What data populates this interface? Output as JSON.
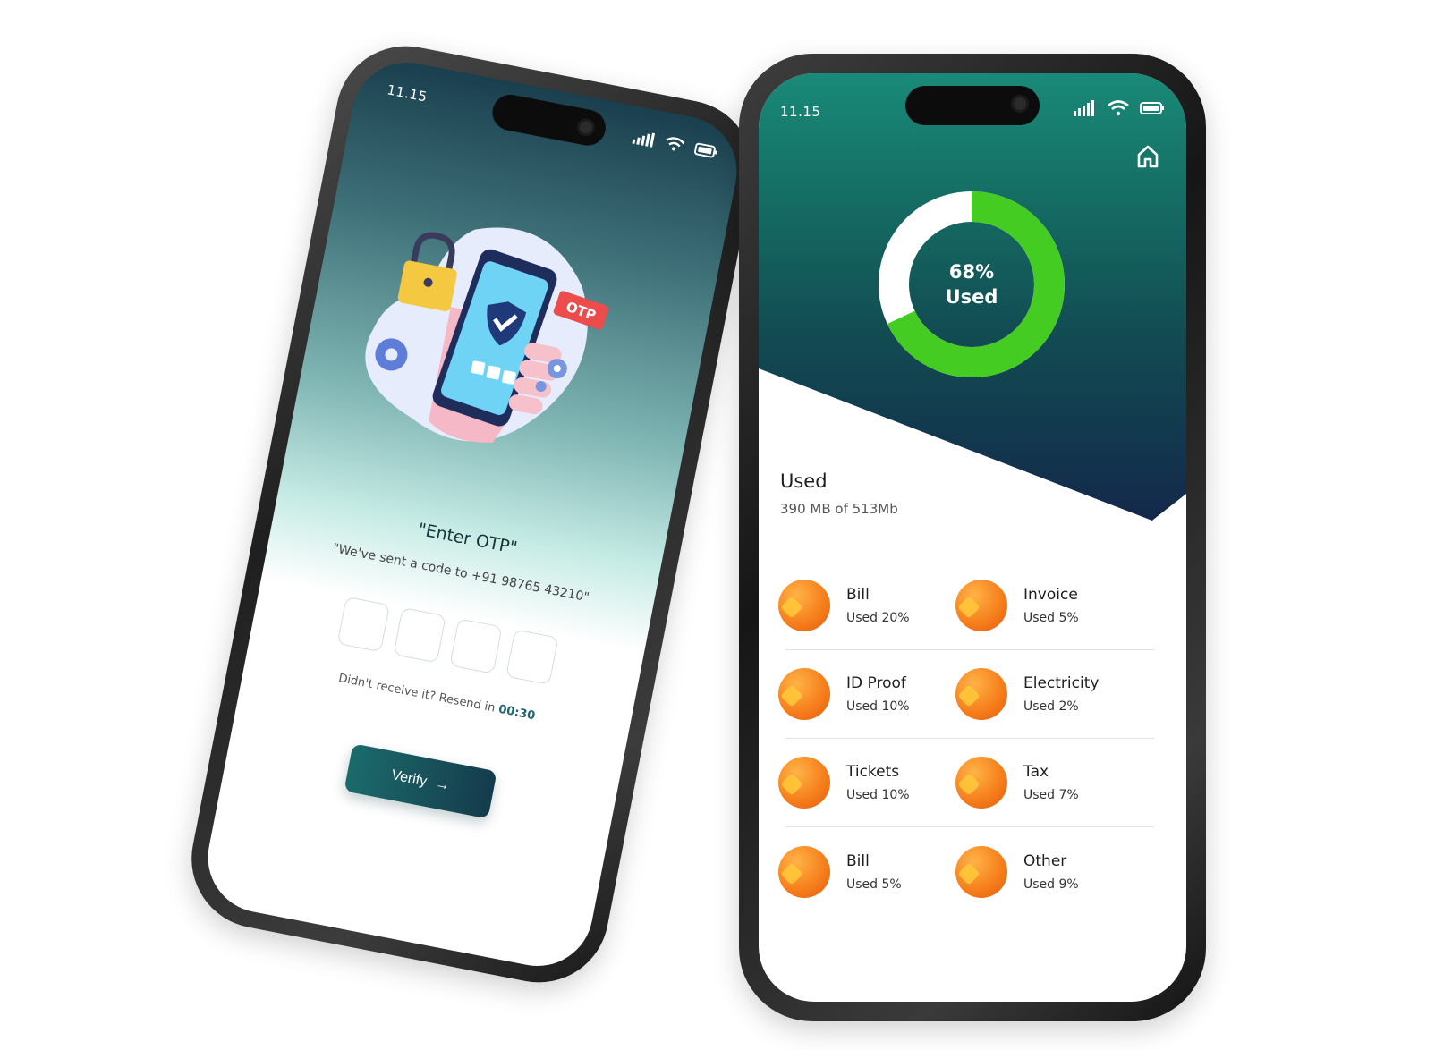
{
  "otp_screen": {
    "time": "11.15",
    "badge": "OTP",
    "title": "\"Enter OTP\"",
    "subtitle": "\"We've sent a code to +91 98765 43210\"",
    "resend_text": "Didn't receive it? Resend in",
    "resend_timer": "00:30",
    "verify_label": "Verify",
    "arrow": "→"
  },
  "storage_screen": {
    "time": "11.15",
    "donut": {
      "percent_text": "68%",
      "label": "Used",
      "used_fraction": 0.68,
      "used_color": "#44cc22",
      "free_color": "#ffffff"
    },
    "used_title": "Used",
    "used_sub": "390 MB of 513Mb",
    "categories": [
      {
        "name": "Bill",
        "used": "Used 20%"
      },
      {
        "name": "Invoice",
        "used": "Used 5%"
      },
      {
        "name": "ID Proof",
        "used": "Used 10%"
      },
      {
        "name": "Electricity",
        "used": "Used 2%"
      },
      {
        "name": "Tickets",
        "used": "Used 10%"
      },
      {
        "name": "Tax",
        "used": "Used  7%"
      },
      {
        "name": "Bill",
        "used": "Used 5%"
      },
      {
        "name": "Other",
        "used": "Used  9%"
      }
    ]
  }
}
